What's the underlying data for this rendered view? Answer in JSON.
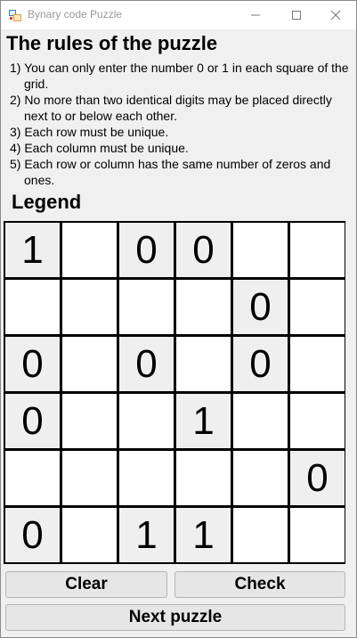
{
  "window": {
    "title": "Bynary code Puzzle",
    "controls": {
      "minimize": "—",
      "maximize": "☐",
      "close": "✕"
    }
  },
  "rules": {
    "title": "The rules of the puzzle",
    "items": [
      "1) You can only enter the number 0 or 1 in each square of the grid.",
      "2) No more than two identical digits may be placed directly next to or below each other.",
      "3) Each row must be unique.",
      "4) Each column must be unique.",
      "5) Each row or column has the same number of zeros and ones."
    ]
  },
  "legend": {
    "label": "Legend"
  },
  "grid": {
    "rows": [
      [
        "1",
        "",
        "0",
        "0",
        "",
        ""
      ],
      [
        "",
        "",
        "",
        "",
        "0",
        ""
      ],
      [
        "0",
        "",
        "0",
        "",
        "0",
        ""
      ],
      [
        "0",
        "",
        "",
        "1",
        "",
        ""
      ],
      [
        "",
        "",
        "",
        "",
        "",
        "0"
      ],
      [
        "0",
        "",
        "1",
        "1",
        "",
        ""
      ]
    ]
  },
  "buttons": {
    "clear": "Clear",
    "check": "Check",
    "next": "Next puzzle"
  },
  "colors": {
    "given_cell": "#efefef",
    "empty_cell": "#ffffff",
    "grid_line": "#000000",
    "background": "#f0f0f0"
  }
}
